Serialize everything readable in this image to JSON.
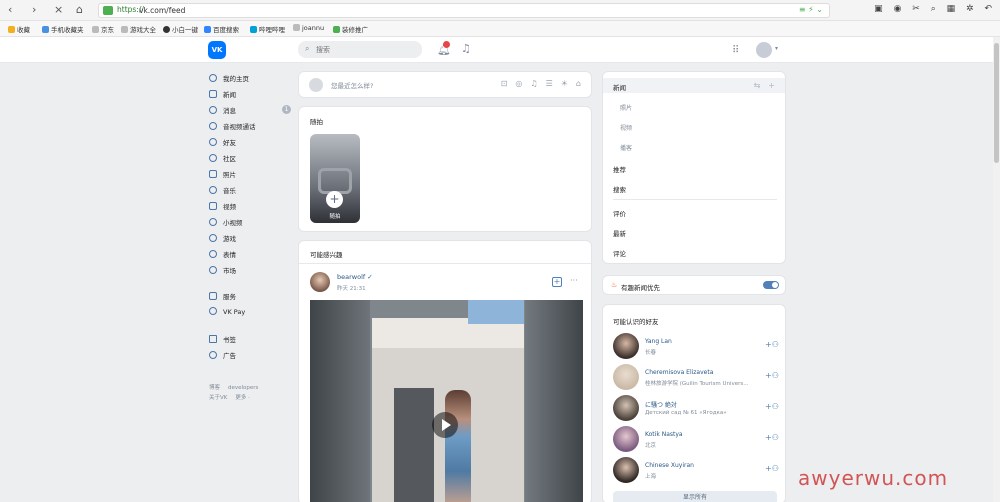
{
  "browser": {
    "scheme": "https://",
    "url": "vk.com/feed",
    "bookmarks": [
      {
        "label": "收藏",
        "color": "#f2b01e"
      },
      {
        "label": "手机收藏夹",
        "color": "#4a90e2"
      },
      {
        "label": "京东",
        "color": "#888888"
      },
      {
        "label": "游戏大全",
        "color": "#888888"
      },
      {
        "label": "小白一键",
        "color": "#333333"
      },
      {
        "label": "百度搜索",
        "color": "#3385ff"
      },
      {
        "label": "哔哩哔哩",
        "color": "#00a1d6"
      },
      {
        "label": "joannu",
        "color": "#888888"
      },
      {
        "label": "装修推广",
        "color": "#4caf50"
      }
    ]
  },
  "header": {
    "logo": "VK",
    "search_placeholder": "搜索"
  },
  "sidebar": {
    "items": [
      {
        "label": "我的主页"
      },
      {
        "label": "新闻"
      },
      {
        "label": "消息"
      },
      {
        "label": "音视频通话"
      },
      {
        "label": "好友"
      },
      {
        "label": "社区"
      },
      {
        "label": "照片"
      },
      {
        "label": "音乐"
      },
      {
        "label": "视频"
      },
      {
        "label": "小视频"
      },
      {
        "label": "游戏"
      },
      {
        "label": "表情"
      },
      {
        "label": "市场"
      },
      {
        "label": "服务"
      },
      {
        "label": "VK Pay"
      },
      {
        "label": "书签"
      },
      {
        "label": "广告"
      }
    ],
    "messages_badge": "1",
    "footer_row1": [
      "博客",
      "developers"
    ],
    "footer_row2": [
      "关于VK",
      "更多 ·"
    ]
  },
  "composer": {
    "placeholder": "您最近怎么样?"
  },
  "stories": {
    "title": "随拍",
    "tile_label": "随拍"
  },
  "recommended": {
    "title": "可能感兴趣",
    "post": {
      "author": "bearwolf ✓",
      "time": "昨天 21:31"
    }
  },
  "feed_menu": {
    "active": "新闻",
    "sub_items": [
      "照片",
      "视频",
      "播客"
    ],
    "items_group1": [
      "推荐",
      "搜索"
    ],
    "items_group2": [
      "评价",
      "最新",
      "评论"
    ]
  },
  "priority": {
    "label": "有趣新闻优先",
    "enabled": true
  },
  "friends": {
    "title": "可能认识的好友",
    "people": [
      {
        "name": "Yang Lan",
        "sub": "长春",
        "color": "#3a2e2a"
      },
      {
        "name": "Cheremisova Elizaveta",
        "sub": "桂林旅游学院 (Guilin Tourism Univers...",
        "color": "#c9b9a6"
      },
      {
        "name": "に騒つ 絶対",
        "sub": "Детский сад № 61 «Ягодка»",
        "color": "#4a4038"
      },
      {
        "name": "Kotik Nastya",
        "sub": "北京",
        "color": "#7a5a7e"
      },
      {
        "name": "Chinese Xuyiran",
        "sub": "上海",
        "color": "#2e2622"
      }
    ],
    "show_all": "显示所有"
  },
  "watermark": "awyerwu.com"
}
